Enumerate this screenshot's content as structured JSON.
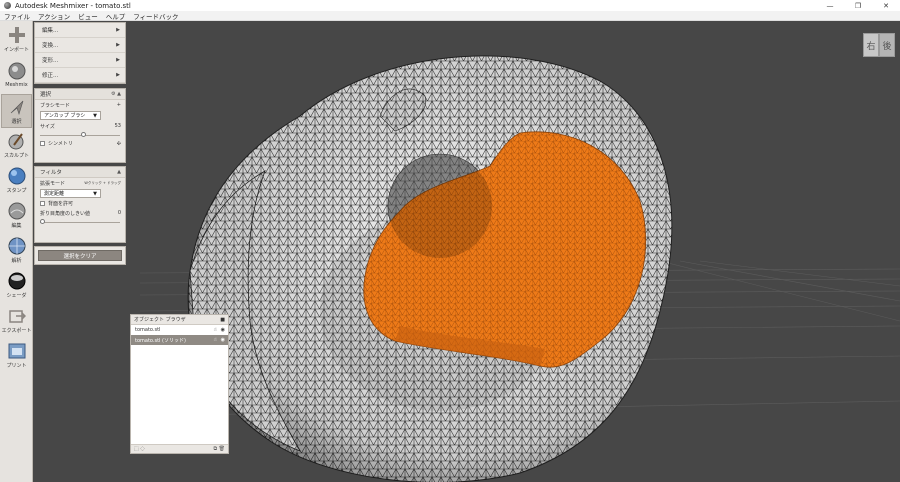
{
  "window": {
    "title": "Autodesk Meshmixer - tomato.stl",
    "minimize_glyph": "—",
    "maximize_glyph": "❐",
    "close_glyph": "✕"
  },
  "menubar": [
    "ファイル",
    "アクション",
    "ビュー",
    "ヘルプ",
    "フィードバック"
  ],
  "toolbar": [
    {
      "label": "インポート",
      "icon": "plus-icon"
    },
    {
      "label": "Meshmix",
      "icon": "sphere-icon"
    },
    {
      "label": "選択",
      "icon": "cursor-arrow-icon",
      "active": true
    },
    {
      "label": "スカルプト",
      "icon": "brush-icon"
    },
    {
      "label": "スタンプ",
      "icon": "stamp-icon"
    },
    {
      "label": "編集",
      "icon": "edit-sphere-icon"
    },
    {
      "label": "解析",
      "icon": "analysis-sphere-icon"
    },
    {
      "label": "シェーダ",
      "icon": "shader-sphere-icon"
    },
    {
      "label": "エクスポート",
      "icon": "export-icon"
    },
    {
      "label": "プリント",
      "icon": "printer-icon"
    }
  ],
  "edit_menu": [
    {
      "label": "編集..."
    },
    {
      "label": "変換..."
    },
    {
      "label": "変形..."
    },
    {
      "label": "修正..."
    }
  ],
  "select_panel": {
    "title": "選択",
    "brush_mode_label": "ブラシモード",
    "brush_mode_marker": "+",
    "brush_type": "アンカップ ブラシ",
    "size_label": "サイズ",
    "size_value": "53",
    "size_fraction": 0.55,
    "symmetry_label": "シンメトリ"
  },
  "filter_panel": {
    "title": "フィルタ",
    "expand_mode_label": "拡張モード",
    "expand_mode_hint": "Wクリック + ドラッグ",
    "expand_mode": "測定距離",
    "allow_back_label": "背面を許可",
    "crease_angle_label": "折り目角度のしきい値",
    "crease_angle_value": "0",
    "crease_angle_fraction": 0.0
  },
  "clear_selection_label": "選択をクリア",
  "object_browser": {
    "title": "オブジェクト ブラウザ",
    "objects": [
      {
        "name": "tomato.stl",
        "selected": false
      },
      {
        "name": "tomato.stl (ソリッド)",
        "selected": true
      }
    ]
  },
  "viewcube": {
    "right_face": "右",
    "back_face": "後"
  },
  "colors": {
    "background": "#474747",
    "mesh_wire": "#cfcfcf",
    "selection": "#ef7b1a",
    "panel": "#eae7e3"
  }
}
